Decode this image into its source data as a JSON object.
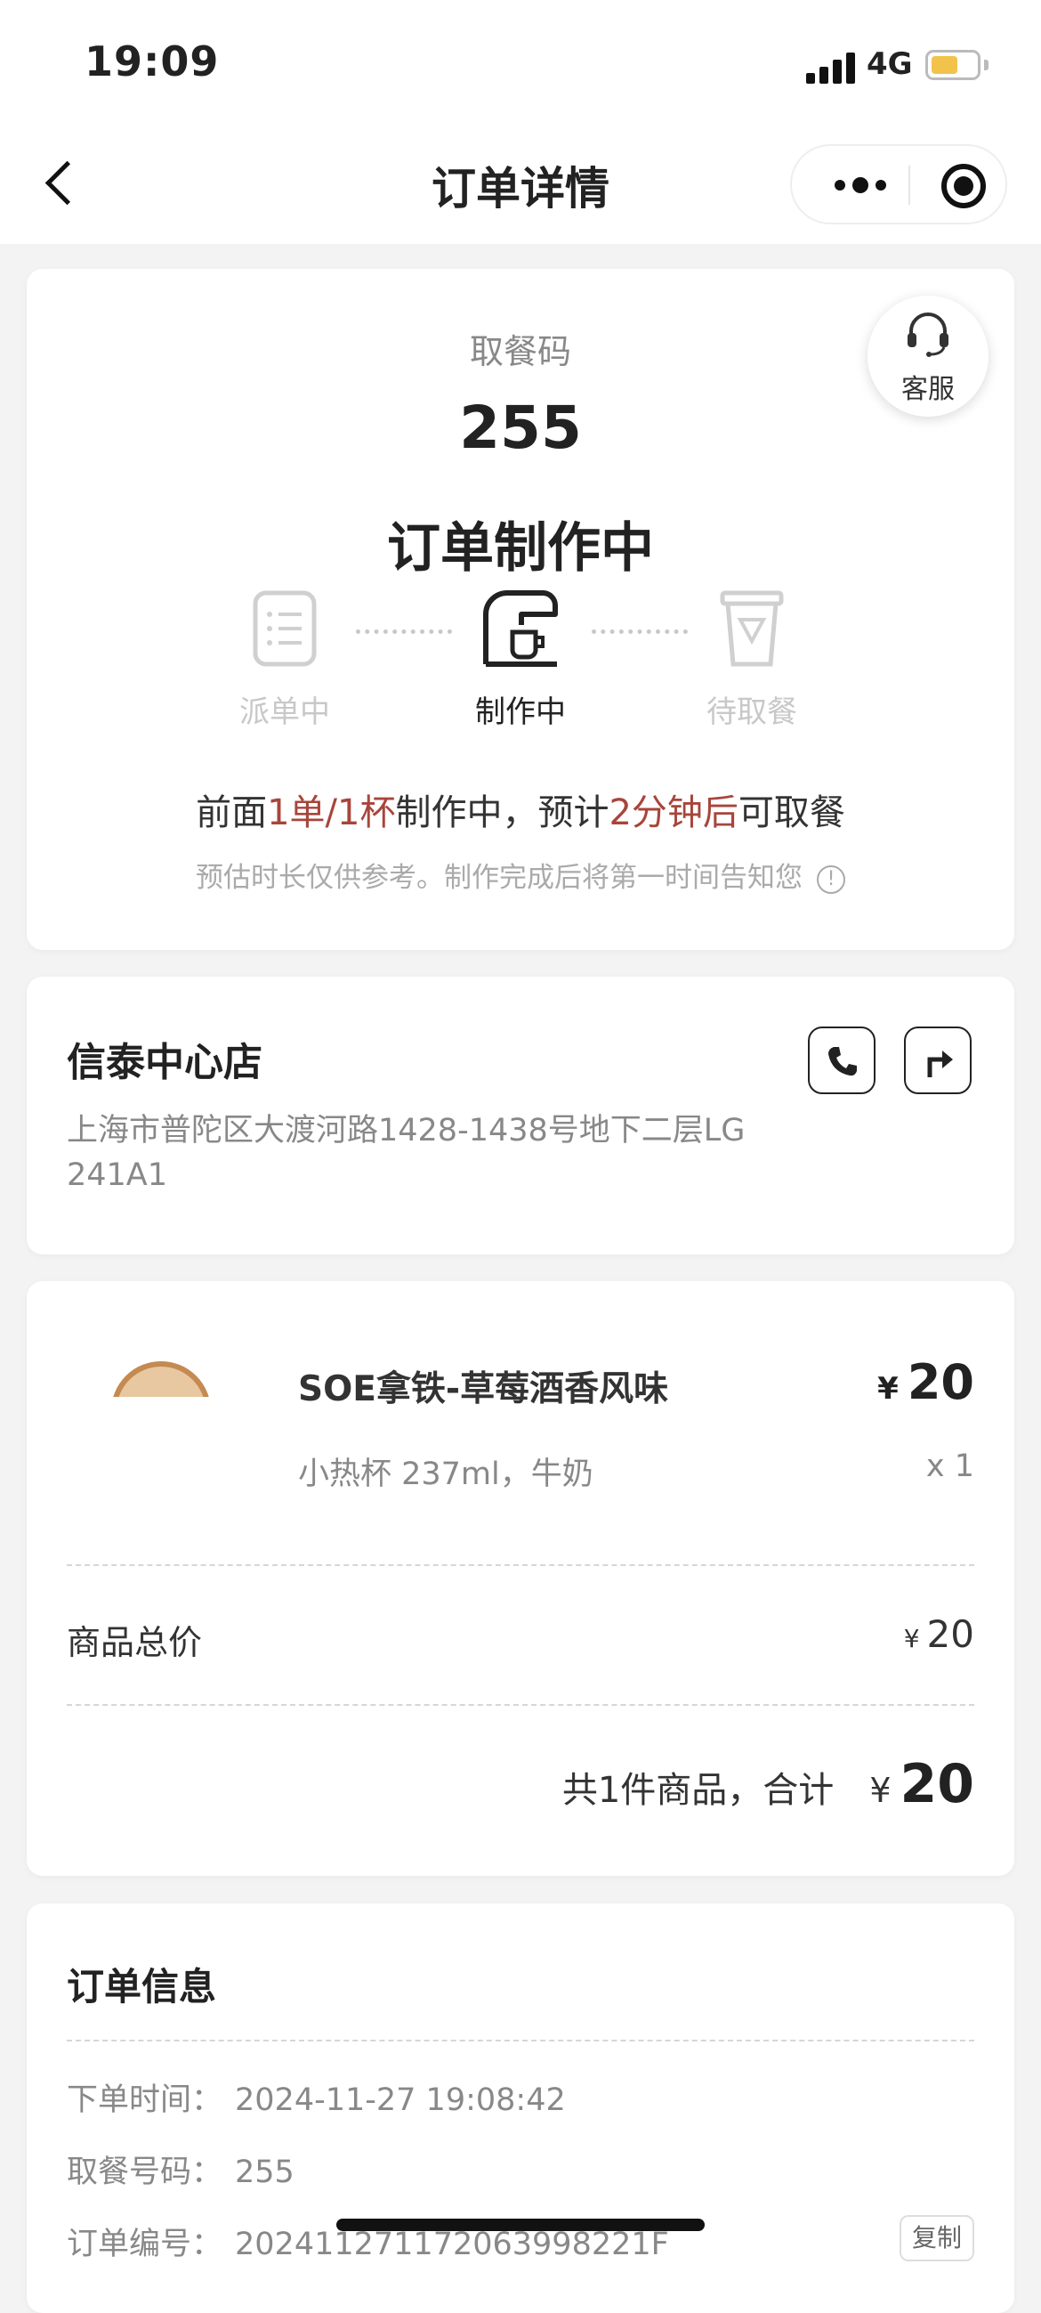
{
  "status_bar": {
    "time": "19:09",
    "network": "4G",
    "battery_level": 0.6
  },
  "navbar": {
    "title": "订单详情",
    "back_icon": "chevron-left-icon",
    "more_icon": "more-dots-icon",
    "close_icon": "target-icon"
  },
  "order_status": {
    "pickup_label": "取餐码",
    "pickup_code": "255",
    "status_title": "订单制作中",
    "customer_service_label": "客服",
    "steps": [
      {
        "label": "派单中",
        "icon": "list-icon",
        "active": false
      },
      {
        "label": "制作中",
        "icon": "coffee-machine-icon",
        "active": true
      },
      {
        "label": "待取餐",
        "icon": "cup-icon",
        "active": false
      }
    ],
    "eta": {
      "part1": "前面",
      "hl1": "1单/1杯",
      "part2": "制作中，预计",
      "hl2": "2分钟后",
      "part3": "可取餐"
    },
    "eta_note": "预估时长仅供参考。制作完成后将第一时间告知您",
    "highlight_color": "#a8453b"
  },
  "store": {
    "name": "信泰中心店",
    "address": "上海市普陀区大渡河路1428-1438号地下二层LG 241A1",
    "phone_icon": "phone-icon",
    "navigate_icon": "navigate-icon"
  },
  "product": {
    "name": "SOE拿铁-草莓酒香风味",
    "currency": "¥",
    "price": "20",
    "spec": "小热杯 237ml，牛奶",
    "quantity": "x 1",
    "subtotal_label": "商品总价",
    "subtotal_value": "20",
    "total_text": "共1件商品，合计",
    "total_value": "20"
  },
  "order_info": {
    "title": "订单信息",
    "rows": [
      {
        "label": "下单时间：",
        "value": "2024-11-27 19:08:42"
      },
      {
        "label": "取餐号码：",
        "value": "255"
      },
      {
        "label": "订单编号：",
        "value": "2024112711720639982​21F"
      }
    ],
    "copy_label": "复制"
  }
}
